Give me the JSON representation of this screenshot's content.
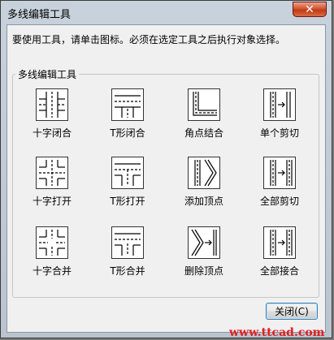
{
  "window": {
    "title": "多线编辑工具",
    "close_glyph": "✕"
  },
  "instruction": "要使用工具，请单击图标。必须在选定工具之后执行对象选择。",
  "group": {
    "title": "多线编辑工具",
    "tools": [
      {
        "label": "十字闭合",
        "icon": "cross-closed-icon"
      },
      {
        "label": "T形闭合",
        "icon": "tee-closed-icon"
      },
      {
        "label": "角点结合",
        "icon": "corner-joint-icon"
      },
      {
        "label": "单个剪切",
        "icon": "cut-single-icon"
      },
      {
        "label": "十字打开",
        "icon": "cross-open-icon"
      },
      {
        "label": "T形打开",
        "icon": "tee-open-icon"
      },
      {
        "label": "添加顶点",
        "icon": "add-vertex-icon"
      },
      {
        "label": "全部剪切",
        "icon": "cut-all-icon"
      },
      {
        "label": "十字合并",
        "icon": "cross-merged-icon"
      },
      {
        "label": "T形合并",
        "icon": "tee-merged-icon"
      },
      {
        "label": "删除顶点",
        "icon": "delete-vertex-icon"
      },
      {
        "label": "全部接合",
        "icon": "weld-all-icon"
      }
    ]
  },
  "close_button": {
    "label": "关闭(C)"
  },
  "watermark": "www.ttcad.com"
}
